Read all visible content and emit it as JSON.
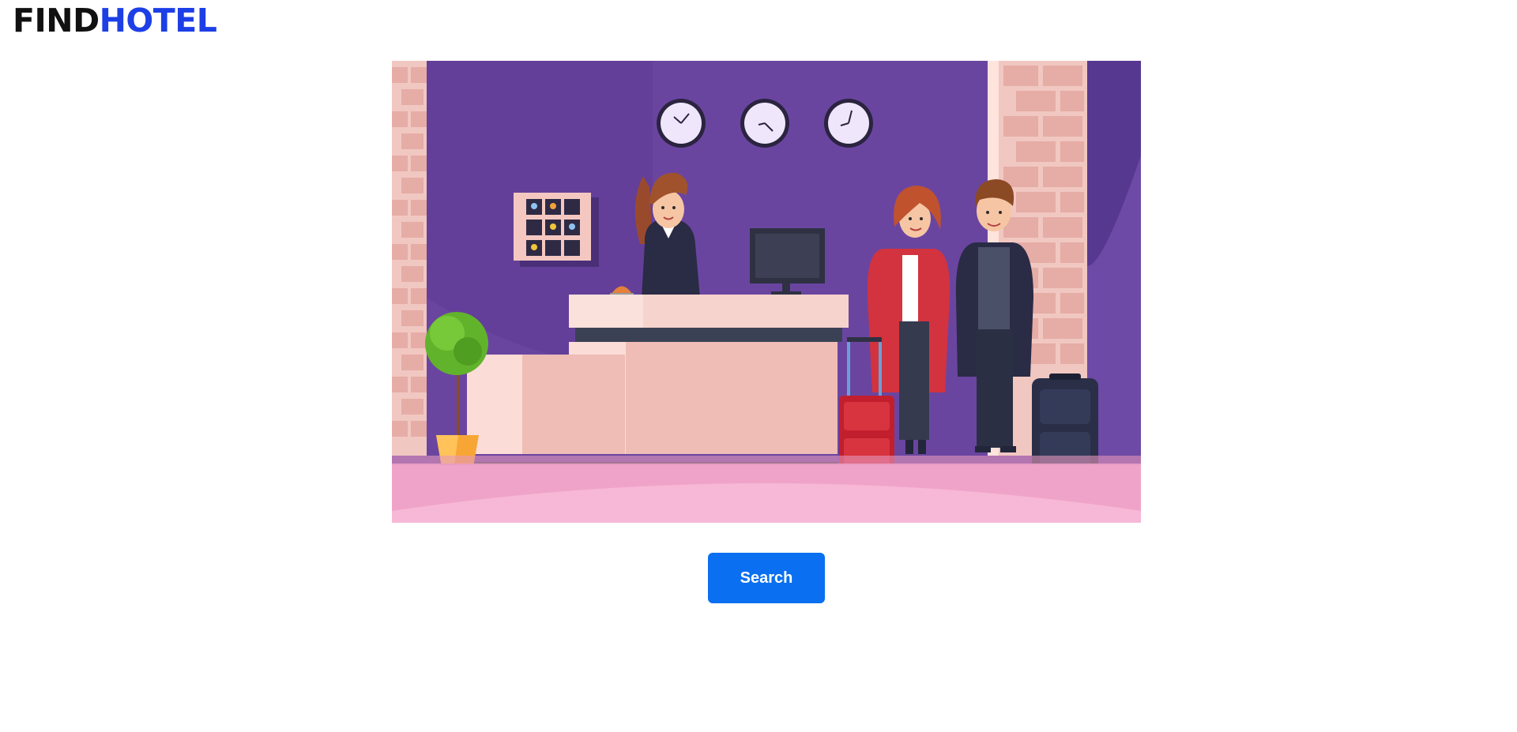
{
  "header": {
    "logo_part1": "FIND",
    "logo_part2": "HOTEL"
  },
  "hero": {
    "illustration": "hotel-reception-illustration"
  },
  "actions": {
    "search_label": "Search"
  },
  "colors": {
    "logo_dark": "#111111",
    "logo_accent": "#1d3fe6",
    "button_bg": "#0a6ff0",
    "button_text": "#ffffff",
    "wall_purple": "#6a45a0"
  }
}
